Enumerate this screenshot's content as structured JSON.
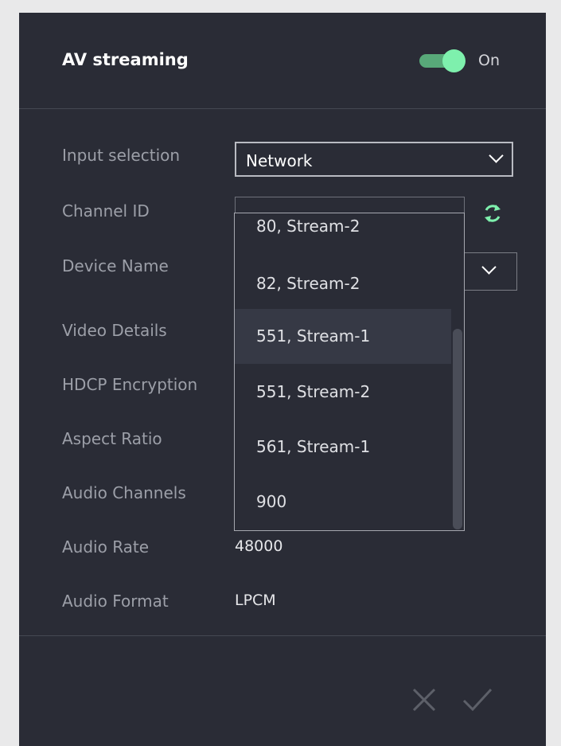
{
  "header": {
    "title": "AV streaming",
    "toggle_state": "On",
    "toggle_color": "#7ef0ad"
  },
  "rows": [
    {
      "label": "Input selection"
    },
    {
      "label": "Channel ID"
    },
    {
      "label": "Device Name"
    },
    {
      "label": "Video Details"
    },
    {
      "label": "HDCP Encryption"
    },
    {
      "label": "Aspect Ratio"
    },
    {
      "label": "Audio Channels"
    },
    {
      "label": "Audio Rate",
      "value": "48000"
    },
    {
      "label": "Audio Format",
      "value": "LPCM"
    }
  ],
  "input_selection": {
    "value": "Network",
    "icon": "chevron-down-icon"
  },
  "channel_id": {
    "refresh_icon": "refresh-icon"
  },
  "channel_dropdown": {
    "options": [
      "80, Stream-2",
      "82, Stream-2",
      "551, Stream-1",
      "551, Stream-2",
      "561, Stream-1",
      "900"
    ],
    "highlighted": "551, Stream-1"
  },
  "footer": {
    "cancel_icon": "close-icon",
    "confirm_icon": "check-icon"
  }
}
